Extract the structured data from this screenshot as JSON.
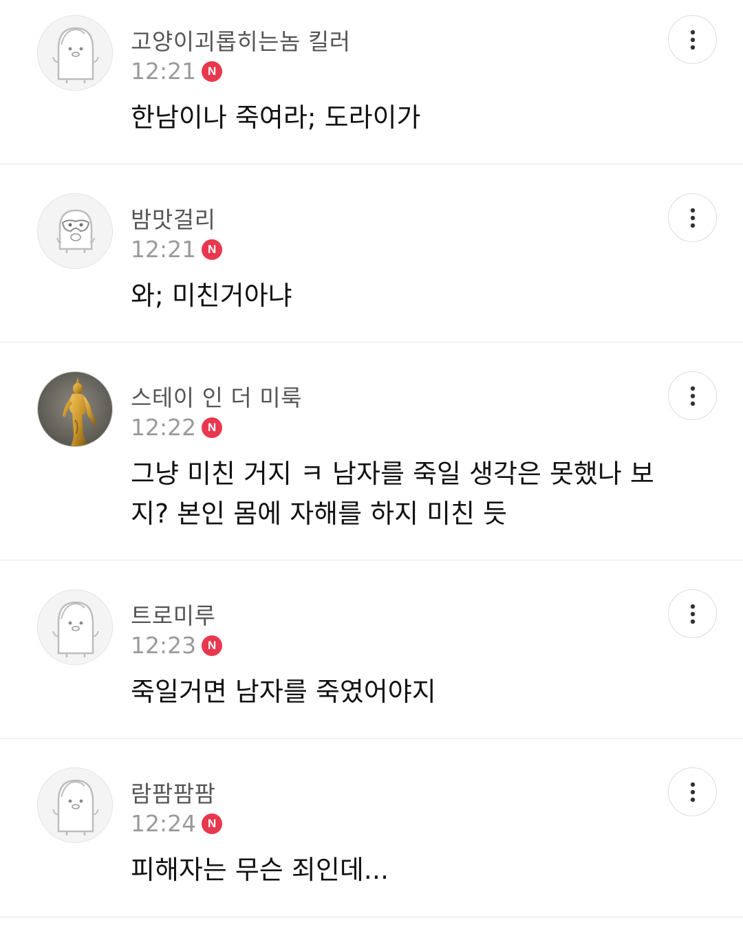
{
  "comments": [
    {
      "nickname": "고양이괴롭히는놈 킬러",
      "time": "12:21",
      "badge": "N",
      "text": "한남이나 죽여라; 도라이가",
      "avatar": "penguin-avatar-icon"
    },
    {
      "nickname": "밤맛걸리",
      "time": "12:21",
      "badge": "N",
      "text": "와; 미친거아냐",
      "avatar": "masked-penguin-avatar-icon"
    },
    {
      "nickname": "스테이 인 더 미룩",
      "time": "12:22",
      "badge": "N",
      "text": "그냥 미친 거지 ㅋ 남자를 죽일 생각은 못했나 보지? 본인 몸에 자해를 하지 미친 듯",
      "avatar": "golden-statue-photo"
    },
    {
      "nickname": "트로미루",
      "time": "12:23",
      "badge": "N",
      "text": "죽일거면 남자를 죽였어야지",
      "avatar": "penguin-avatar-icon"
    },
    {
      "nickname": "람팜팜팜",
      "time": "12:24",
      "badge": "N",
      "text": "피해자는 무슨 죄인데...",
      "avatar": "penguin-avatar-icon"
    }
  ],
  "more_button_icon": "vertical-ellipsis-icon",
  "colors": {
    "new_badge": "#e8384f",
    "time": "#9a9a9a",
    "nickname": "#555555",
    "text": "#111111",
    "divider": "#e6e6e6"
  }
}
